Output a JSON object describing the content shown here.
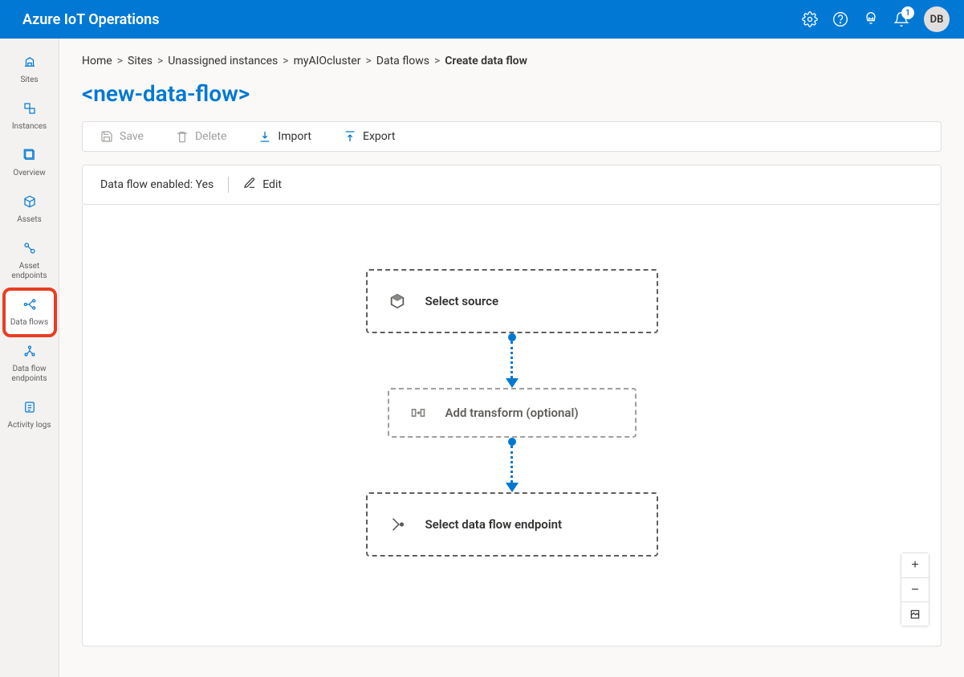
{
  "app": {
    "title": "Azure IoT Operations"
  },
  "topbar": {
    "notification_count": "1",
    "user_initials": "DB"
  },
  "sidebar": {
    "items": [
      {
        "label": "Sites"
      },
      {
        "label": "Instances"
      },
      {
        "label": "Overview"
      },
      {
        "label": "Assets"
      },
      {
        "label": "Asset endpoints"
      },
      {
        "label": "Data flows"
      },
      {
        "label": "Data flow endpoints"
      },
      {
        "label": "Activity logs"
      }
    ]
  },
  "breadcrumb": {
    "items": [
      "Home",
      "Sites",
      "Unassigned instances",
      "myAIOcluster",
      "Data flows"
    ],
    "current": "Create data flow"
  },
  "page": {
    "title": "<new-data-flow>"
  },
  "toolbar": {
    "save_label": "Save",
    "delete_label": "Delete",
    "import_label": "Import",
    "export_label": "Export"
  },
  "status": {
    "enabled_label": "Data flow enabled: Yes",
    "edit_label": "Edit"
  },
  "flow": {
    "select_source": "Select source",
    "add_transform": "Add transform (optional)",
    "select_endpoint": "Select data flow endpoint"
  },
  "zoom": {
    "in": "+",
    "out": "−"
  }
}
